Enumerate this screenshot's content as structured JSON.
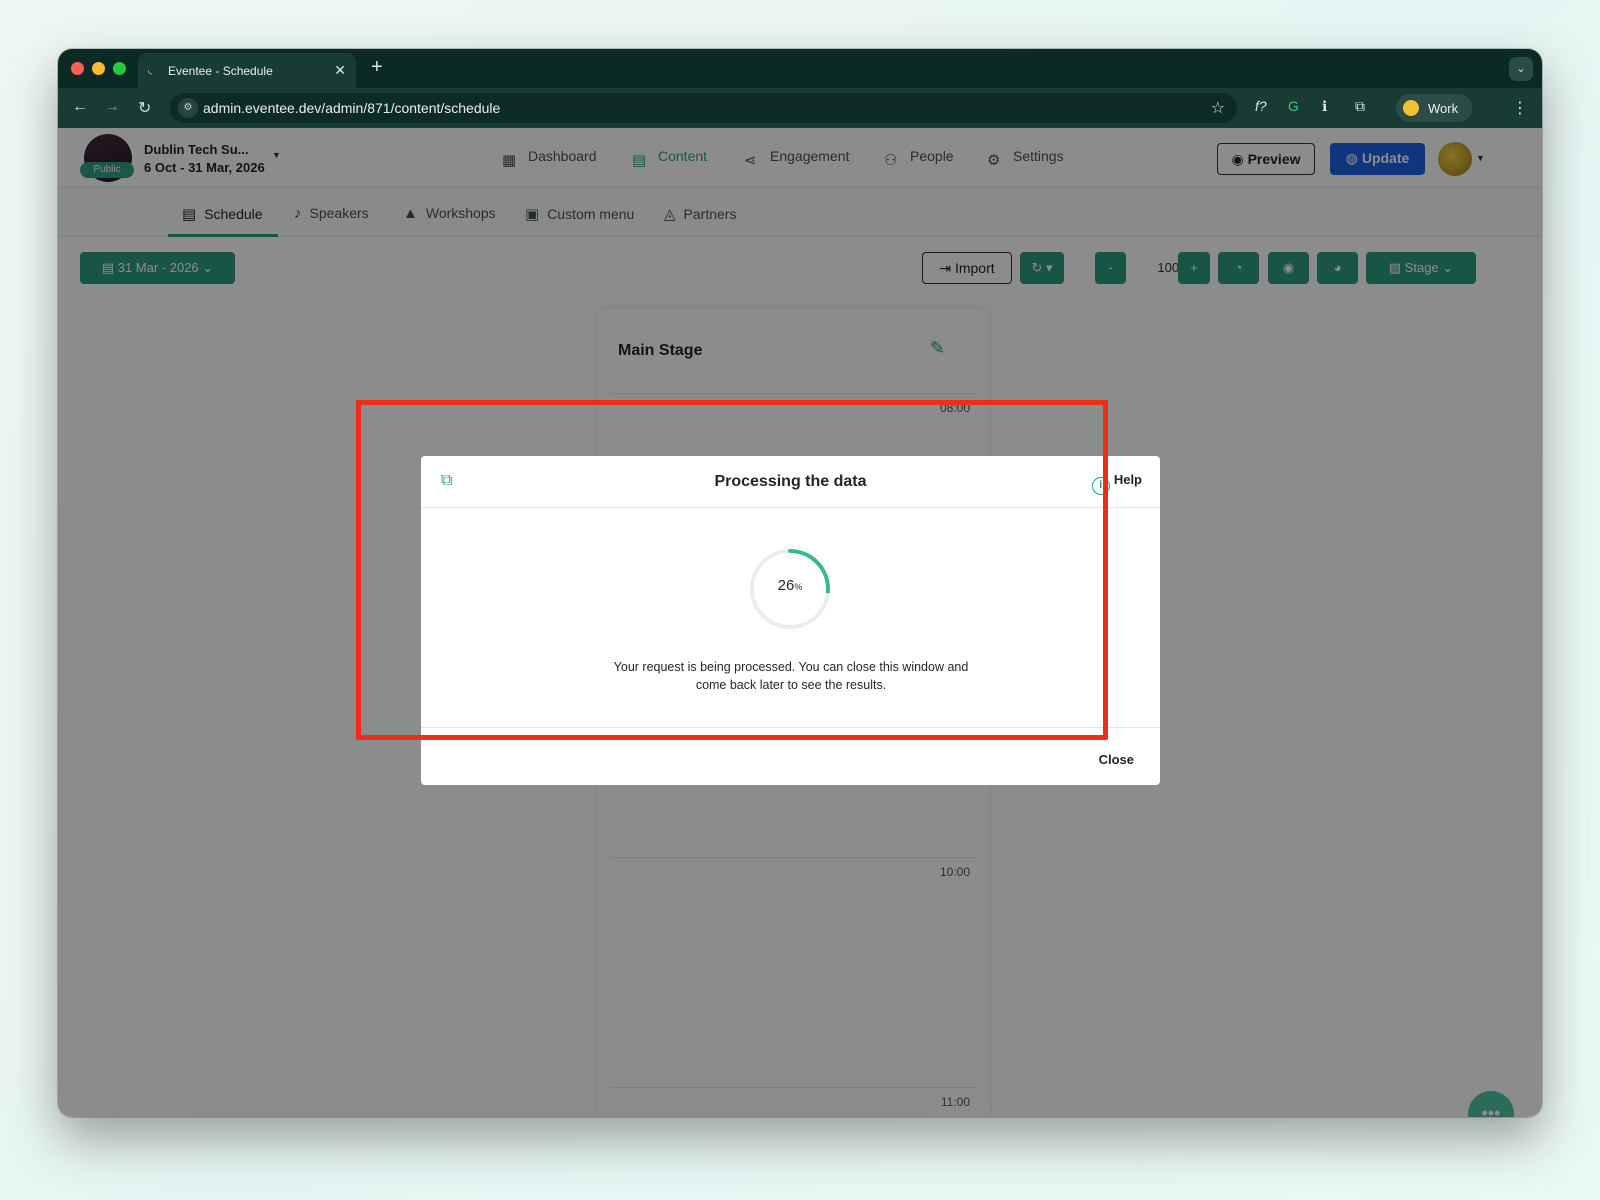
{
  "browser": {
    "tab_title": "Eventee - Schedule",
    "url": "admin.eventee.dev/admin/871/content/schedule",
    "profile_label": "Work"
  },
  "event": {
    "name": "Dublin Tech Su...",
    "dates": "6 Oct - 31 Mar, 2026",
    "visibility": "Public"
  },
  "main_nav": [
    {
      "label": "Dashboard",
      "icon": "dashboard-icon",
      "active": false
    },
    {
      "label": "Content",
      "icon": "calendar-icon",
      "active": true
    },
    {
      "label": "Engagement",
      "icon": "share-icon",
      "active": false
    },
    {
      "label": "People",
      "icon": "people-icon",
      "active": false
    },
    {
      "label": "Settings",
      "icon": "gear-icon",
      "active": false
    }
  ],
  "header_actions": {
    "preview_label": "Preview",
    "update_label": "Update"
  },
  "sub_nav": [
    {
      "label": "Schedule",
      "icon": "calendar-icon",
      "active": true
    },
    {
      "label": "Speakers",
      "icon": "microphone-icon",
      "active": false
    },
    {
      "label": "Workshops",
      "icon": "graduation-cap-icon",
      "active": false
    },
    {
      "label": "Custom menu",
      "icon": "document-icon",
      "active": false
    },
    {
      "label": "Partners",
      "icon": "handshake-icon",
      "active": false
    }
  ],
  "controls": {
    "date_selector": "31 Mar - 2026",
    "import_label": "Import",
    "zoom_minus": "-",
    "zoom_value": "100%",
    "zoom_plus": "+",
    "view_selector": "Stage"
  },
  "stage": {
    "title": "Main Stage",
    "times": [
      "08:00",
      "10:00",
      "11:00"
    ]
  },
  "modal": {
    "title": "Processing the data",
    "help_label": "Help",
    "progress_value": "26",
    "progress_unit": "%",
    "progress_fraction": 0.26,
    "message_line1": "Your request is being processed. You can close this window and",
    "message_line2": "come back later to see the results.",
    "close_label": "Close",
    "accent_color": "#2a9d7f",
    "highlight_color": "#ef2b1c"
  }
}
